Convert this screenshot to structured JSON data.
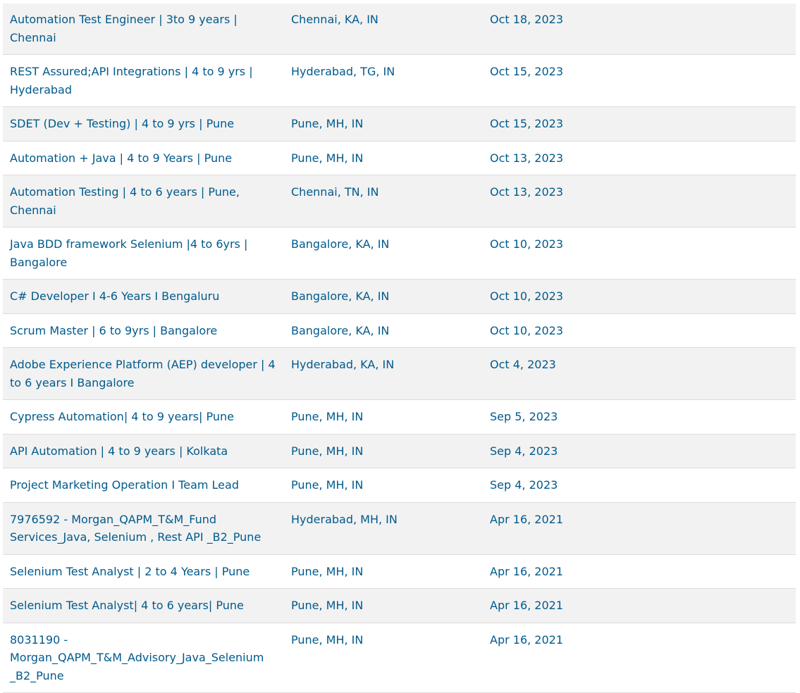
{
  "jobs": [
    {
      "title": "Automation Test Engineer | 3to 9 years | Chennai",
      "location": "Chennai, KA, IN",
      "date": "Oct 18, 2023"
    },
    {
      "title": "REST Assured;API Integrations | 4 to 9 yrs | Hyderabad",
      "location": "Hyderabad, TG, IN",
      "date": "Oct 15, 2023"
    },
    {
      "title": "SDET (Dev + Testing) | 4 to 9 yrs | Pune",
      "location": "Pune, MH, IN",
      "date": "Oct 15, 2023"
    },
    {
      "title": "Automation + Java | 4 to 9 Years | Pune",
      "location": "Pune, MH, IN",
      "date": "Oct 13, 2023"
    },
    {
      "title": "Automation Testing | 4 to 6 years | Pune, Chennai",
      "location": "Chennai, TN, IN",
      "date": "Oct 13, 2023"
    },
    {
      "title": "Java BDD framework Selenium |4 to 6yrs | Bangalore",
      "location": "Bangalore, KA, IN",
      "date": "Oct 10, 2023"
    },
    {
      "title": "C# Developer I 4-6 Years I Bengaluru",
      "location": "Bangalore, KA, IN",
      "date": "Oct 10, 2023"
    },
    {
      "title": "Scrum Master | 6 to 9yrs | Bangalore",
      "location": "Bangalore, KA, IN",
      "date": "Oct 10, 2023"
    },
    {
      "title": "Adobe Experience Platform (AEP) developer | 4 to 6 years I Bangalore",
      "location": "Hyderabad, KA, IN",
      "date": "Oct 4, 2023"
    },
    {
      "title": "Cypress Automation| 4 to 9 years| Pune",
      "location": "Pune, MH, IN",
      "date": "Sep 5, 2023"
    },
    {
      "title": "API Automation | 4 to 9 years | Kolkata",
      "location": "Pune, MH, IN",
      "date": "Sep 4, 2023"
    },
    {
      "title": "Project Marketing Operation I Team Lead",
      "location": "Pune, MH, IN",
      "date": "Sep 4, 2023"
    },
    {
      "title": "7976592 - Morgan_QAPM_T&M_Fund Services_Java, Selenium , Rest API _B2_Pune",
      "location": "Hyderabad, MH, IN",
      "date": "Apr 16, 2021"
    },
    {
      "title": "Selenium Test Analyst | 2 to 4 Years | Pune",
      "location": "Pune, MH, IN",
      "date": "Apr 16, 2021"
    },
    {
      "title": "Selenium Test Analyst| 4 to 6 years| Pune",
      "location": "Pune, MH, IN",
      "date": "Apr 16, 2021"
    },
    {
      "title": "8031190 - Morgan_QAPM_T&M_Advisory_Java_Selenium _B2_Pune",
      "location": "Pune, MH, IN",
      "date": "Apr 16, 2021"
    }
  ]
}
